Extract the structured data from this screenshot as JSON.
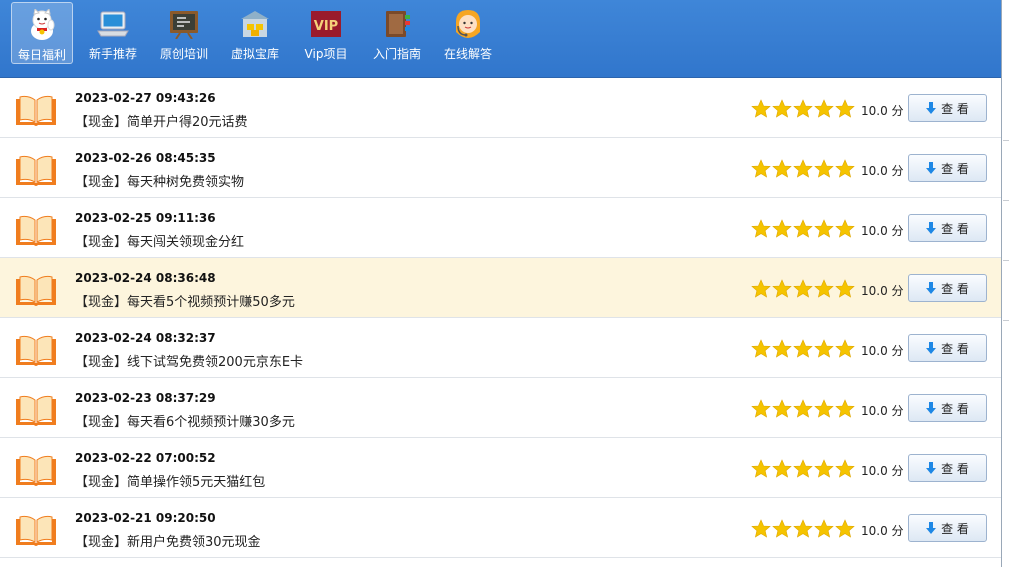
{
  "toolbar": {
    "items": [
      {
        "label": "每日福利",
        "icon": "lucky-cat-icon"
      },
      {
        "label": "新手推荐",
        "icon": "laptop-icon"
      },
      {
        "label": "原创培训",
        "icon": "chalkboard-icon"
      },
      {
        "label": "虚拟宝库",
        "icon": "treasure-house-icon"
      },
      {
        "label": "Vip项目",
        "icon": "vip-icon"
      },
      {
        "label": "入门指南",
        "icon": "book-guide-icon"
      },
      {
        "label": "在线解答",
        "icon": "support-agent-icon"
      }
    ],
    "vip_badge": "VIP"
  },
  "list": {
    "items": [
      {
        "date": "2023-02-27 09:43:26",
        "title": "【现金】简单开户得20元话费",
        "rating": 5,
        "score": "10.0 分",
        "button": "查 看"
      },
      {
        "date": "2023-02-26 08:45:35",
        "title": "【现金】每天种树免费领实物",
        "rating": 5,
        "score": "10.0 分",
        "button": "查 看"
      },
      {
        "date": "2023-02-25 09:11:36",
        "title": "【现金】每天闯关领现金分红",
        "rating": 5,
        "score": "10.0 分",
        "button": "查 看"
      },
      {
        "date": "2023-02-24 08:36:48",
        "title": "【现金】每天看5个视频预计赚50多元",
        "rating": 5,
        "score": "10.0 分",
        "button": "查 看"
      },
      {
        "date": "2023-02-24 08:32:37",
        "title": "【现金】线下试驾免费领200元京东E卡",
        "rating": 5,
        "score": "10.0 分",
        "button": "查 看"
      },
      {
        "date": "2023-02-23 08:37:29",
        "title": "【现金】每天看6个视频预计赚30多元",
        "rating": 5,
        "score": "10.0 分",
        "button": "查 看"
      },
      {
        "date": "2023-02-22 07:00:52",
        "title": "【现金】简单操作领5元天猫红包",
        "rating": 5,
        "score": "10.0 分",
        "button": "查 看"
      },
      {
        "date": "2023-02-21 09:20:50",
        "title": "【现金】新用户免费领30元现金",
        "rating": 5,
        "score": "10.0 分",
        "button": "查 看"
      }
    ]
  },
  "colors": {
    "toolbar": "#3a80d4",
    "highlight_row": "#fdf5dd",
    "star": "#f5c400",
    "book": "#f07d1e"
  }
}
